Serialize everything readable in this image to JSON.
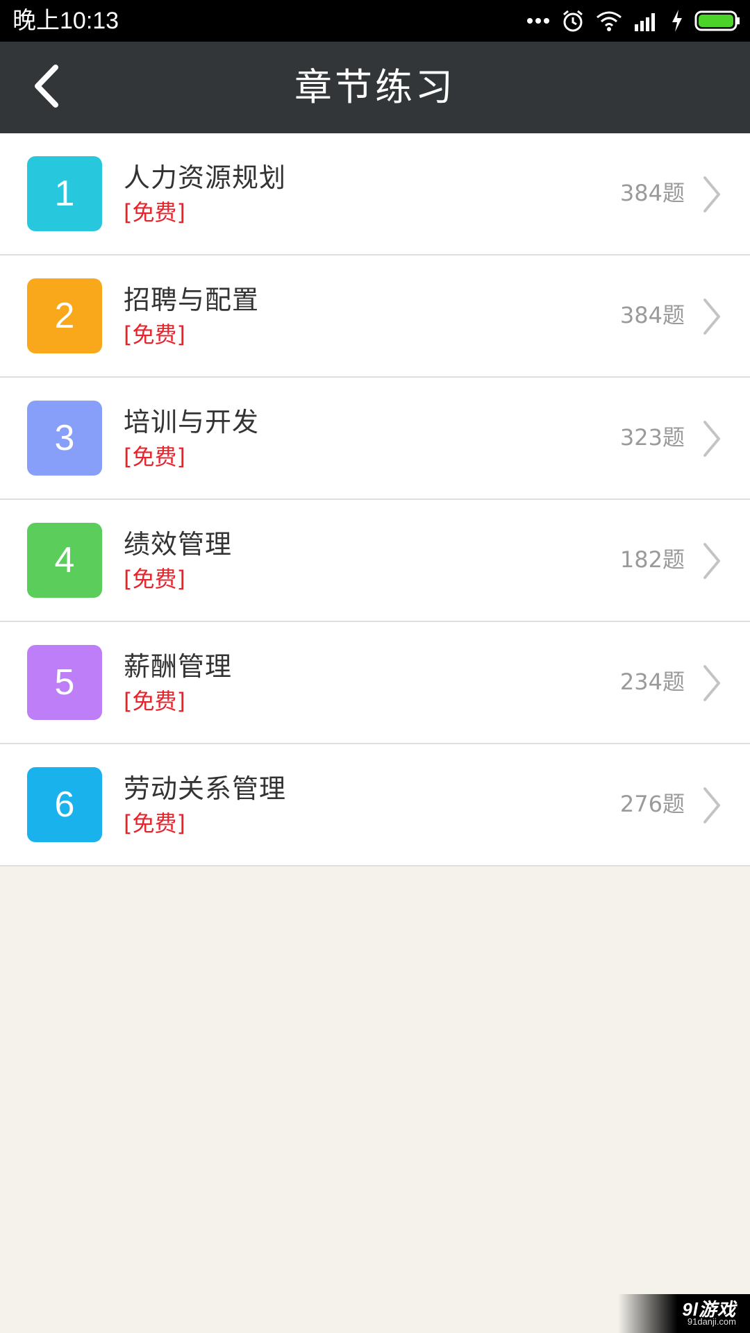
{
  "status_bar": {
    "time": "晚上10:13",
    "icons": [
      "more-dots-icon",
      "alarm-icon",
      "wifi-icon",
      "signal-icon",
      "charging-icon",
      "battery-icon"
    ],
    "battery_color": "#4cd32a"
  },
  "header": {
    "title": "章节练习",
    "back_icon": "chevron-left-icon",
    "background": "#323638"
  },
  "chapters": [
    {
      "number": "1",
      "title": "人力资源规划",
      "tag": "[免费]",
      "count": "384题",
      "color": "#27c8de"
    },
    {
      "number": "2",
      "title": "招聘与配置",
      "tag": "[免费]",
      "count": "384题",
      "color": "#f9a81b"
    },
    {
      "number": "3",
      "title": "培训与开发",
      "tag": "[免费]",
      "count": "323题",
      "color": "#879ff9"
    },
    {
      "number": "4",
      "title": "绩效管理",
      "tag": "[免费]",
      "count": "182题",
      "color": "#5acd5a"
    },
    {
      "number": "5",
      "title": "薪酬管理",
      "tag": "[免费]",
      "count": "234题",
      "color": "#be7ef7"
    },
    {
      "number": "6",
      "title": "劳动关系管理",
      "tag": "[免费]",
      "count": "276题",
      "color": "#1ab2ed"
    }
  ],
  "watermark": {
    "logo": "9l游戏",
    "domain": "91danji.com"
  }
}
